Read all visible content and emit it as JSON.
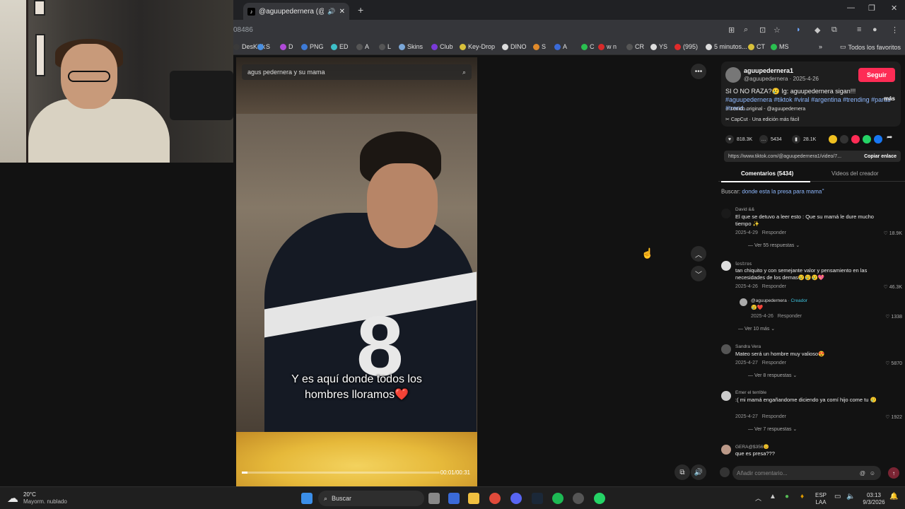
{
  "browser": {
    "tab_title": "@aguupedernera (@aguup",
    "tab_favicon": "tiktok-icon",
    "new_tab_label": "+",
    "url_partial": "08486",
    "window_controls": [
      "—",
      "❐",
      "✕"
    ]
  },
  "bookmarks": [
    {
      "label": "DesKick",
      "color": "#3a3a3a"
    },
    {
      "label": "S",
      "color": "#4a8fe0"
    },
    {
      "label": "D",
      "color": "#b04ad8"
    },
    {
      "label": "PNG",
      "color": "#3d7ad6"
    },
    {
      "label": "ED",
      "color": "#3dc0c8"
    },
    {
      "label": "A",
      "color": "#555"
    },
    {
      "label": "L",
      "color": "#555"
    },
    {
      "label": "Skins",
      "color": "#7aa7d8"
    },
    {
      "label": "Club",
      "color": "#7a3ad8"
    },
    {
      "label": "Key-Drop",
      "color": "#d8c03a"
    },
    {
      "label": "DINO",
      "color": "#ddd"
    },
    {
      "label": "S",
      "color": "#e08a2a"
    },
    {
      "label": "A",
      "color": "#3a6ad8"
    },
    {
      "label": "C",
      "color": "#2ac050"
    },
    {
      "label": "w n",
      "color": "#d82a2a"
    },
    {
      "label": "CR",
      "color": "#555"
    },
    {
      "label": "YS",
      "color": "#ddd"
    },
    {
      "label": "(995)",
      "color": "#e02a2a"
    },
    {
      "label": "5 minutos...",
      "color": "#ddd"
    },
    {
      "label": "CT",
      "color": "#d8c03a"
    },
    {
      "label": "MS",
      "color": "#2ac050"
    }
  ],
  "bookmarks_more": "»",
  "bookmarks_folder": "Todos los favoritos",
  "video": {
    "search_placeholder": "agus pedernera y su mama",
    "caption_line1": "Y es aquí donde todos los",
    "caption_line2": "hombres lloramos❤️",
    "time": "00:01/00:31",
    "progress": 0.03
  },
  "post": {
    "username": "aguupedernera1",
    "handle_date": "@aguupedernera · 2025-4-26",
    "follow_label": "Seguir",
    "description": "SI O NO RAZA?😢 Ig: aguupedernera sigan!!! ",
    "hashtags": "#aguupedernera #tiktok #viral #argentina #trending #parati #trend...",
    "more_label": "más",
    "sound": "sonido original - @aguupedernera",
    "capcut": "CapCut · Una edición más fácil",
    "likes": "818.3K",
    "comments": "5434",
    "saves": "28.1K",
    "link": "https://www.tiktok.com/@aguupedernera1/video/7...",
    "copy_label": "Copiar enlace"
  },
  "tabs": {
    "comments": "Comentarios (5434)",
    "creator_videos": "Videos del creador"
  },
  "search_line": {
    "prefix": "Buscar:",
    "query": "donde esta la presa para mama"
  },
  "comments": [
    {
      "name": "David &&",
      "text": "El que se detuvo a leer esto : Que su mamá le dure mucho tiempo ✨",
      "date": "2025-4-29",
      "reply": "Responder",
      "likes": "18.9K",
      "more": "Ver 55 respuestas ⌄"
    },
    {
      "name": "𝕝𝕖𝕤𝕥𝕣𝕠𝕤",
      "text": "tan chiquito y con semejante valor y pensamiento en las necesidades de los demas😢😢😢💖",
      "date": "2025-4-26",
      "reply": "Responder",
      "likes": "46.3K",
      "more": ""
    },
    {
      "name": "Sandra Vera",
      "text": "Mateo será un hombre muy valioso😍",
      "date": "2025-4-27",
      "reply": "Responder",
      "likes": "5870",
      "more": "Ver 8 respuestas ⌄"
    },
    {
      "name": "Emer el terrible",
      "text": ":( mi mamá engañandome diciendo ya comí hijo come tu 🥲",
      "date": "2025-4-27",
      "reply": "Responder",
      "likes": "1922",
      "more": "Ver 7 respuestas ⌄"
    },
    {
      "name": "GERA@$356😊",
      "text": "que es presa???",
      "date": "",
      "reply": "",
      "likes": "",
      "more": ""
    }
  ],
  "creator_reply": {
    "name": "@aguupedernera",
    "badge": "· Creador",
    "text": "😢❤️",
    "date": "2025-4-26",
    "reply": "Responder",
    "likes": "1338",
    "more": "Ver 10 más ⌄"
  },
  "comment_input_placeholder": "Añadir comentario...",
  "taskbar": {
    "weather_temp": "20°C",
    "weather_desc": "Mayorm. nublado",
    "search_label": "Buscar",
    "lang_line1": "ESP",
    "lang_line2": "LAA",
    "time": "03:13",
    "date": "9/3/2026"
  }
}
